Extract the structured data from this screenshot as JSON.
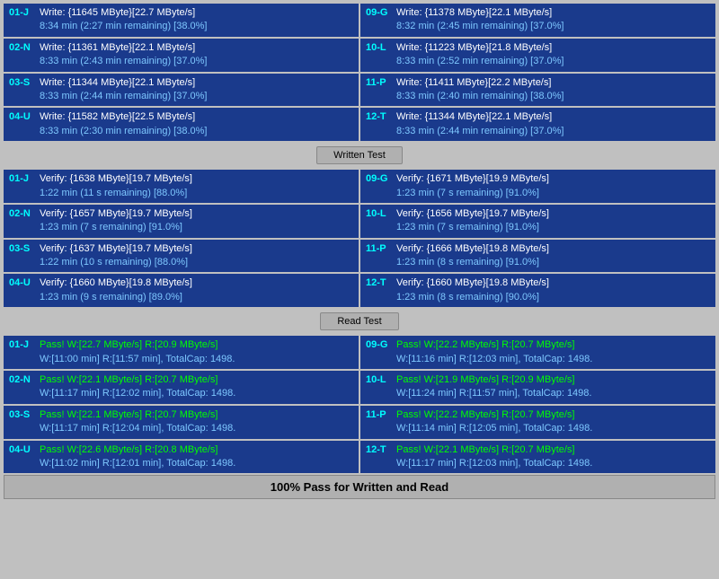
{
  "sections": {
    "write_section": {
      "rows": [
        {
          "left_id": "01-J",
          "left_line1": "Write: {11645 MByte}[22.7 MByte/s]",
          "left_line2": "8:34 min (2:27 min remaining)  [38.0%]",
          "right_id": "09-G",
          "right_line1": "Write: {11378 MByte}[22.1 MByte/s]",
          "right_line2": "8:32 min (2:45 min remaining)  [37.0%]"
        },
        {
          "left_id": "02-N",
          "left_line1": "Write: {11361 MByte}[22.1 MByte/s]",
          "left_line2": "8:33 min (2:43 min remaining)  [37.0%]",
          "right_id": "10-L",
          "right_line1": "Write: {11223 MByte}[21.8 MByte/s]",
          "right_line2": "8:33 min (2:52 min remaining)  [37.0%]"
        },
        {
          "left_id": "03-S",
          "left_line1": "Write: {11344 MByte}[22.1 MByte/s]",
          "left_line2": "8:33 min (2:44 min remaining)  [37.0%]",
          "right_id": "11-P",
          "right_line1": "Write: {11411 MByte}[22.2 MByte/s]",
          "right_line2": "8:33 min (2:40 min remaining)  [38.0%]"
        },
        {
          "left_id": "04-U",
          "left_line1": "Write: {11582 MByte}[22.5 MByte/s]",
          "left_line2": "8:33 min (2:30 min remaining)  [38.0%]",
          "right_id": "12-T",
          "right_line1": "Write: {11344 MByte}[22.1 MByte/s]",
          "right_line2": "8:33 min (2:44 min remaining)  [37.0%]"
        }
      ]
    },
    "write_label": "Written Test",
    "verify_section": {
      "rows": [
        {
          "left_id": "01-J",
          "left_line1": "Verify: {1638 MByte}[19.7 MByte/s]",
          "left_line2": "1:22 min (11 s remaining)  [88.0%]",
          "right_id": "09-G",
          "right_line1": "Verify: {1671 MByte}[19.9 MByte/s]",
          "right_line2": "1:23 min (7 s remaining)  [91.0%]"
        },
        {
          "left_id": "02-N",
          "left_line1": "Verify: {1657 MByte}[19.7 MByte/s]",
          "left_line2": "1:23 min (7 s remaining)  [91.0%]",
          "right_id": "10-L",
          "right_line1": "Verify: {1656 MByte}[19.7 MByte/s]",
          "right_line2": "1:23 min (7 s remaining)  [91.0%]"
        },
        {
          "left_id": "03-S",
          "left_line1": "Verify: {1637 MByte}[19.7 MByte/s]",
          "left_line2": "1:22 min (10 s remaining)  [88.0%]",
          "right_id": "11-P",
          "right_line1": "Verify: {1666 MByte}[19.8 MByte/s]",
          "right_line2": "1:23 min (8 s remaining)  [91.0%]"
        },
        {
          "left_id": "04-U",
          "left_line1": "Verify: {1660 MByte}[19.8 MByte/s]",
          "left_line2": "1:23 min (9 s remaining)  [89.0%]",
          "right_id": "12-T",
          "right_line1": "Verify: {1660 MByte}[19.8 MByte/s]",
          "right_line2": "1:23 min (8 s remaining)  [90.0%]"
        }
      ]
    },
    "read_label": "Read Test",
    "pass_section": {
      "rows": [
        {
          "left_id": "01-J",
          "left_line1": "Pass! W:[22.7 MByte/s] R:[20.9 MByte/s]",
          "left_line2": "W:[11:00 min] R:[11:57 min], TotalCap: 1498.",
          "right_id": "09-G",
          "right_line1": "Pass! W:[22.2 MByte/s] R:[20.7 MByte/s]",
          "right_line2": "W:[11:16 min] R:[12:03 min], TotalCap: 1498."
        },
        {
          "left_id": "02-N",
          "left_line1": "Pass! W:[22.1 MByte/s] R:[20.7 MByte/s]",
          "left_line2": "W:[11:17 min] R:[12:02 min], TotalCap: 1498.",
          "right_id": "10-L",
          "right_line1": "Pass! W:[21.9 MByte/s] R:[20.9 MByte/s]",
          "right_line2": "W:[11:24 min] R:[11:57 min], TotalCap: 1498."
        },
        {
          "left_id": "03-S",
          "left_line1": "Pass! W:[22.1 MByte/s] R:[20.7 MByte/s]",
          "left_line2": "W:[11:17 min] R:[12:04 min], TotalCap: 1498.",
          "right_id": "11-P",
          "right_line1": "Pass! W:[22.2 MByte/s] R:[20.7 MByte/s]",
          "right_line2": "W:[11:14 min] R:[12:05 min], TotalCap: 1498."
        },
        {
          "left_id": "04-U",
          "left_line1": "Pass! W:[22.6 MByte/s] R:[20.8 MByte/s]",
          "left_line2": "W:[11:02 min] R:[12:01 min], TotalCap: 1498.",
          "right_id": "12-T",
          "right_line1": "Pass! W:[22.1 MByte/s] R:[20.7 MByte/s]",
          "right_line2": "W:[11:17 min] R:[12:03 min], TotalCap: 1498."
        }
      ]
    },
    "bottom_status": "100% Pass for Written and Read"
  }
}
